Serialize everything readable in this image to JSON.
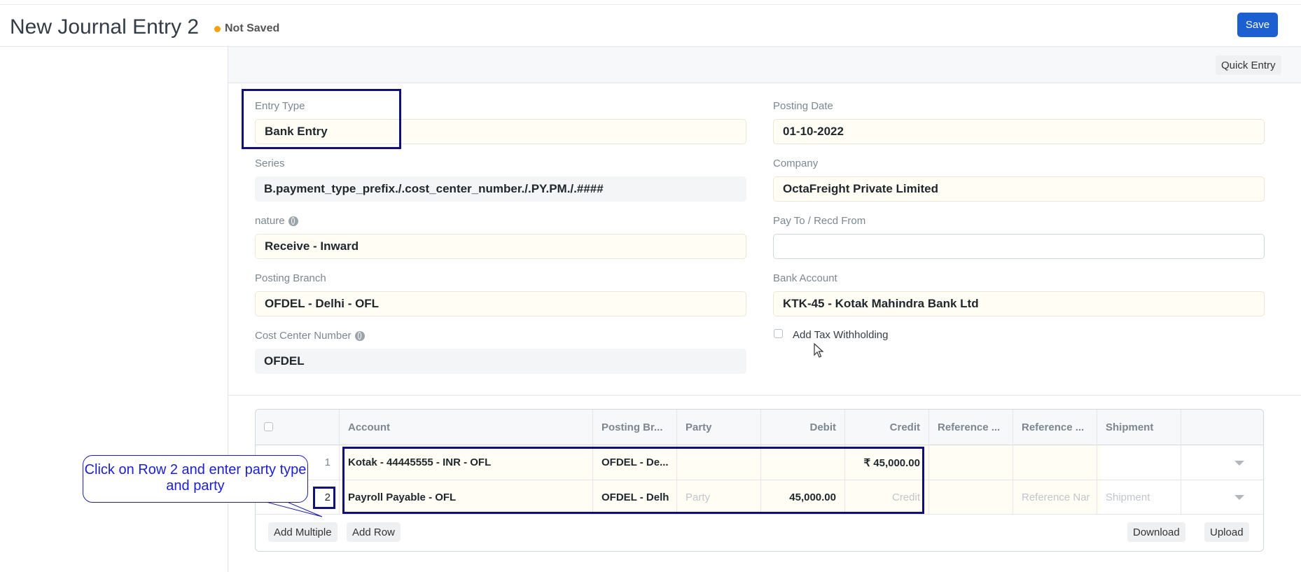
{
  "header": {
    "title": "New Journal Entry 2",
    "status": "Not Saved",
    "save_label": "Save",
    "status_color": "#f2a20b",
    "primary_color": "#1b5fd0"
  },
  "toolbar": {
    "quick_entry_label": "Quick Entry"
  },
  "fields": {
    "entry_type": {
      "label": "Entry Type",
      "value": "Bank Entry"
    },
    "posting_date": {
      "label": "Posting Date",
      "value": "01-10-2022"
    },
    "series": {
      "label": "Series",
      "value": "B.payment_type_prefix./.cost_center_number./.PY.PM./.####"
    },
    "company": {
      "label": "Company",
      "value": "OctaFreight Private Limited"
    },
    "nature": {
      "label": "nature",
      "value": "Receive - Inward"
    },
    "pay_to": {
      "label": "Pay To / Recd From",
      "value": ""
    },
    "posting_branch": {
      "label": "Posting Branch",
      "value": "OFDEL - Delhi - OFL"
    },
    "bank_account": {
      "label": "Bank Account",
      "value": "KTK-45 - Kotak Mahindra Bank Ltd"
    },
    "cost_center": {
      "label": "Cost Center Number",
      "value": "OFDEL"
    },
    "tax_withholding": {
      "label": "Add Tax Withholding",
      "checked": false
    }
  },
  "table": {
    "columns": [
      "Account",
      "Posting Br...",
      "Party",
      "Debit",
      "Credit",
      "Reference ...",
      "Reference ...",
      "Shipment"
    ],
    "rows": [
      {
        "idx": "1",
        "account": "Kotak - 44445555 - INR - OFL",
        "branch": "OFDEL - De...",
        "party": "",
        "debit": "",
        "credit": "₹ 45,000.00",
        "ref_type": "",
        "ref_name": "",
        "shipment": ""
      },
      {
        "idx": "2",
        "account": "Payroll Payable - OFL",
        "branch": "OFDEL - Delh",
        "party": "Party",
        "debit": "45,000.00",
        "credit": "Credit",
        "ref_type": "",
        "ref_name": "Reference Nar",
        "shipment": "Shipment"
      }
    ],
    "buttons": {
      "add_multiple": "Add Multiple",
      "add_row": "Add Row",
      "download": "Download",
      "upload": "Upload"
    }
  },
  "annotation": {
    "callout_text": "Click on Row 2 and enter party type and party",
    "highlight_color": "#10107a"
  }
}
